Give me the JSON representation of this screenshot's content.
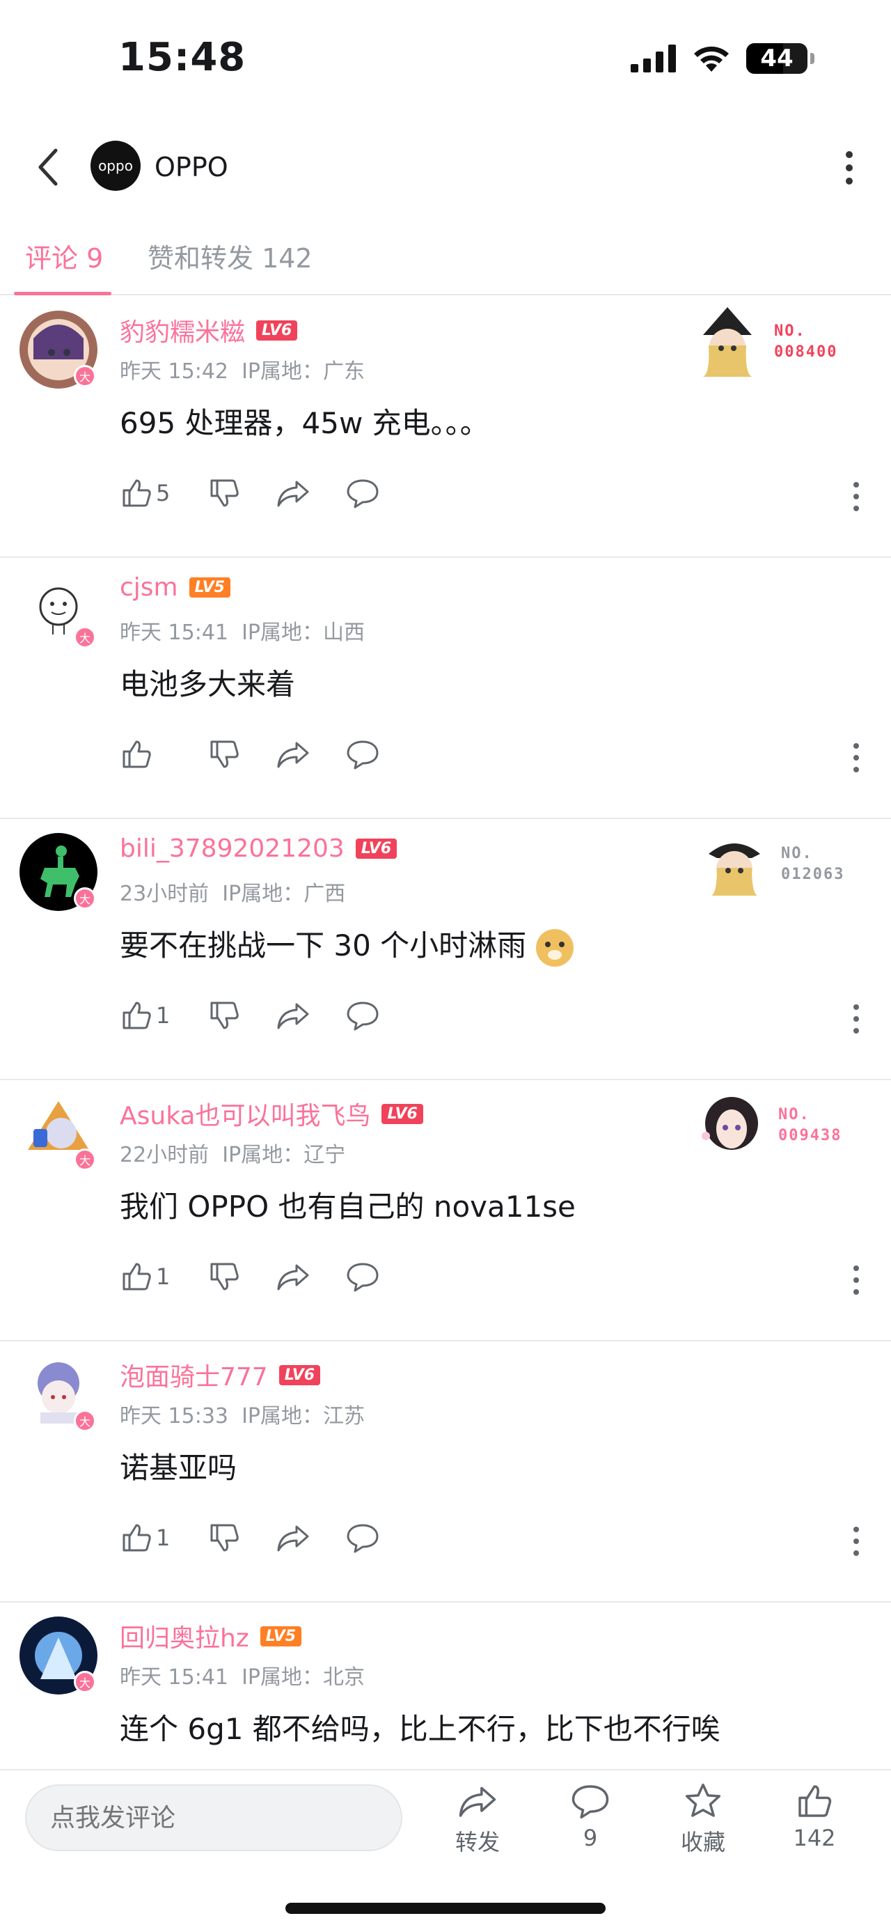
{
  "status": {
    "time": "15:48",
    "battery": "44"
  },
  "header": {
    "logo_text": "oppo",
    "title": "OPPO"
  },
  "tabs": [
    {
      "label": "评论 9"
    },
    {
      "label": "赞和转发 142"
    }
  ],
  "comments": [
    {
      "name": "豹豹糯米糍",
      "level": "LV6",
      "time": "昨天 15:42",
      "ip": "IP属地：广东",
      "content": "695 处理器，45w 充电。。。",
      "likes": "5",
      "fan_no": "NO.",
      "fan_num": "008400",
      "fan_color": "#f0435b"
    },
    {
      "name": "cjsm",
      "level": "LV5",
      "time": "昨天 15:41",
      "ip": "IP属地：山西",
      "content": "电池多大来着",
      "likes": ""
    },
    {
      "name": "bili_37892021203",
      "level": "LV6",
      "time": "23小时前",
      "ip": "IP属地：广西",
      "content": "要不在挑战一下 30 个小时淋雨",
      "likes": "1",
      "fan_no": "NO.",
      "fan_num": "012063",
      "fan_color": "#9499a0"
    },
    {
      "name": "Asuka也可以叫我飞鸟",
      "level": "LV6",
      "time": "22小时前",
      "ip": "IP属地：辽宁",
      "content": "我们 OPPO 也有自己的 nova11se",
      "likes": "1",
      "fan_no": "NO.",
      "fan_num": "009438",
      "fan_color": "#fb7299"
    },
    {
      "name": "泡面骑士777",
      "level": "LV6",
      "time": "昨天 15:33",
      "ip": "IP属地：江苏",
      "content": "诺基亚吗",
      "likes": "1"
    },
    {
      "name": "回归奥拉hz",
      "level": "LV5",
      "time": "昨天 15:41",
      "ip": "IP属地：北京",
      "content": "连个 6g1 都不给吗，比上不行，比下也不行唉",
      "likes": ""
    }
  ],
  "avatar_badge": "大",
  "bottom": {
    "placeholder": "点我发评论",
    "share_label": "转发",
    "comment_count": "9",
    "fav_label": "收藏",
    "like_count": "142"
  },
  "colors": {
    "accent": "#fb7299",
    "lv6": "#f0435b",
    "lv5": "#ff7f24"
  },
  "icons": [
    "back-icon",
    "more-vertical-icon",
    "thumb-up-icon",
    "thumb-down-icon",
    "share-icon",
    "comment-icon",
    "star-icon",
    "wifi-icon",
    "signal-icon",
    "battery-icon"
  ]
}
